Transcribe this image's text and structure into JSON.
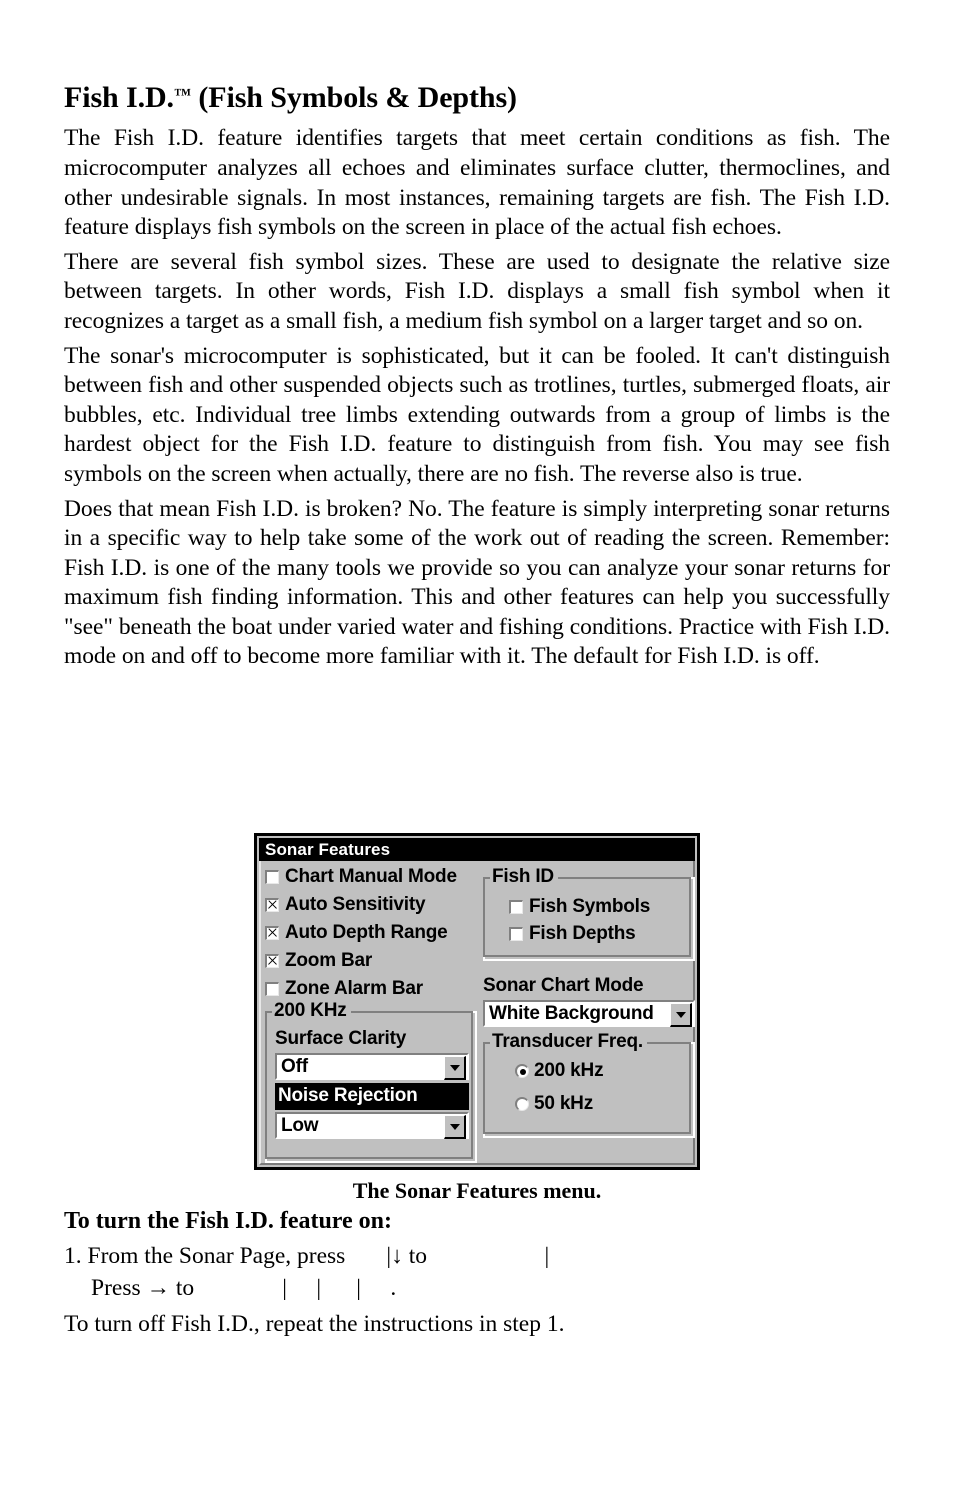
{
  "document": {
    "title": "Fish I.D.",
    "title_tm": "™",
    "title_rest": "(Fish Symbols & Depths)",
    "paragraphs": [
      "The Fish I.D. feature identifies targets that meet certain conditions as fish. The microcomputer analyzes all echoes and eliminates surface clutter, thermoclines, and other undesirable signals. In most instances, remaining targets are fish. The Fish I.D. feature displays fish symbols on the screen in place of the actual fish echoes.",
      "There are several fish symbol sizes. These are used to designate the relative size between targets. In other words, Fish I.D. displays a small fish symbol when it recognizes a target as a small fish, a medium fish symbol on a larger target and so on.",
      "The sonar's microcomputer is sophisticated, but it can be fooled. It can't distinguish between fish and other suspended objects such as trotlines, turtles, submerged floats, air bubbles, etc. Individual tree limbs extending outwards from a group of limbs is the hardest object for the Fish I.D. feature to distinguish from fish. You may see fish symbols on the screen when actually, there are no fish. The reverse also is true.",
      "Does that mean Fish I.D. is broken? No. The feature is simply interpreting sonar returns in a specific way to help take some of the work out of reading the screen. Remember: Fish I.D. is one of the many tools we provide so you can analyze your sonar returns for maximum fish finding information. This and other features can help you successfully \"see\" beneath the boat under varied water and fishing conditions. Practice with Fish I.D. mode on and off to become more familiar with it. The default for Fish I.D. is off."
    ],
    "figure_caption": "The Sonar Features menu.",
    "steps_heading": "To turn the Fish I.D. feature on:",
    "step_1": "1. From the Sonar Page, press       |↓ to                    |",
    "step_1b": "Press → to               |     |      |     .",
    "closing": "To turn off Fish I.D., repeat the instructions in step 1."
  },
  "dialog": {
    "title": "Sonar Features",
    "colors": {
      "face": "#c0c0c0",
      "titlebar_bg": "#000000",
      "titlebar_fg": "#ffffff",
      "field_bg": "#ffffff",
      "shadow": "#808080",
      "highlight": "#ffffff",
      "border": "#000000"
    },
    "checkboxes": [
      {
        "label": "Chart Manual Mode",
        "checked": false
      },
      {
        "label": "Auto Sensitivity",
        "checked": true
      },
      {
        "label": "Auto Depth Range",
        "checked": true
      },
      {
        "label": "Zoom Bar",
        "checked": true
      },
      {
        "label": "Zone Alarm Bar",
        "checked": false
      }
    ],
    "group_200khz": {
      "title": "200 KHz",
      "surface_clarity_label": "Surface Clarity",
      "surface_clarity_value": "Off",
      "noise_rejection_label": "Noise Rejection",
      "noise_rejection_value": "Low"
    },
    "group_fish_id": {
      "title": "Fish ID",
      "checkboxes": [
        {
          "label": "Fish Symbols",
          "checked": false
        },
        {
          "label": "Fish Depths",
          "checked": false
        }
      ]
    },
    "sonar_chart_mode": {
      "label": "Sonar Chart Mode",
      "value": "White Background"
    },
    "group_transducer": {
      "title": "Transducer Freq.",
      "options": [
        {
          "label": "200 kHz",
          "selected": true
        },
        {
          "label": "50 kHz",
          "selected": false
        }
      ]
    }
  }
}
